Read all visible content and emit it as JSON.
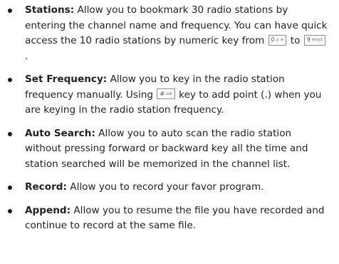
{
  "features": [
    {
      "term": "Stations:",
      "text_a": " Allow you to bookmark 30 radio stations by entering the channel name and frequency. You can have quick access the 10 radio stations by numeric key from ",
      "key1": {
        "main": "0",
        "sub": "⌂ ≡",
        "icon": "key-0-icon"
      },
      "text_b": " to ",
      "key2": {
        "main": "9",
        "sub": "wxyz",
        "icon": "key-9-icon"
      },
      "text_c": " ."
    },
    {
      "term": "Set Frequency:",
      "text_a": " Allow you to key in the radio station frequency manually. Using ",
      "key1": {
        "main": "#",
        "sub": "⌂⊕",
        "icon": "key-hash-icon"
      },
      "text_b": " key to add point (.) when you are keying in the radio station frequency."
    },
    {
      "term": "Auto Search:",
      "text_a": " Allow you to auto scan the radio station without pressing forward or backward key all the time and station searched will be memorized in the channel list."
    },
    {
      "term": "Record:",
      "text_a": " Allow you to record your favor program."
    },
    {
      "term": "Append:",
      "text_a": " Allow you to resume the file you have recorded and continue to record at the same file."
    }
  ]
}
